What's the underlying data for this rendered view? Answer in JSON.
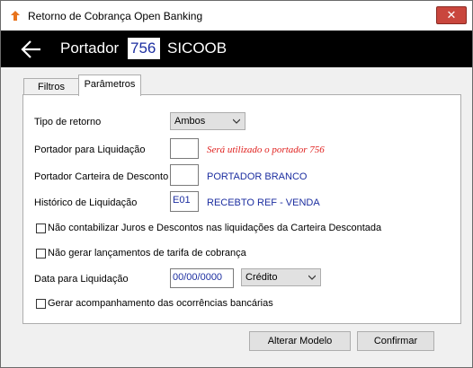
{
  "window": {
    "title": "Retorno de Cobrança Open Banking",
    "close_glyph": "✕"
  },
  "header": {
    "label": "Portador",
    "code": "756",
    "name": "SICOOB"
  },
  "tabs": [
    {
      "label": "Filtros",
      "active": false
    },
    {
      "label": "Parâmetros",
      "active": true
    }
  ],
  "form": {
    "tipo_retorno": {
      "label": "Tipo de retorno",
      "value": "Ambos"
    },
    "portador_liquidacao": {
      "label": "Portador para Liquidação",
      "value": "",
      "hint": "Será utilizado o portador 756"
    },
    "portador_carteira": {
      "label": "Portador Carteira de Desconto",
      "value": "",
      "desc": "PORTADOR BRANCO"
    },
    "historico": {
      "label": "Histórico de Liquidação",
      "value": "E01",
      "desc": "RECEBTO REF - VENDA"
    },
    "chk_juros": {
      "label": "Não contabilizar Juros e Descontos nas liquidações da Carteira Descontada",
      "checked": false
    },
    "chk_tarifa": {
      "label": "Não gerar lançamentos de tarifa de cobrança",
      "checked": false
    },
    "data_liquidacao": {
      "label": "Data para Liquidação",
      "value": "00/00/0000",
      "tipo": "Crédito"
    },
    "chk_acompanhamento": {
      "label": "Gerar acompanhamento das ocorrências bancárias",
      "checked": false
    }
  },
  "buttons": {
    "alterar_modelo": "Alterar Modelo",
    "confirmar": "Confirmar"
  },
  "colors": {
    "header_bg": "#000000",
    "code_text": "#1c2ea0",
    "hint_red": "#e0201e",
    "close_bg": "#c9463d"
  }
}
